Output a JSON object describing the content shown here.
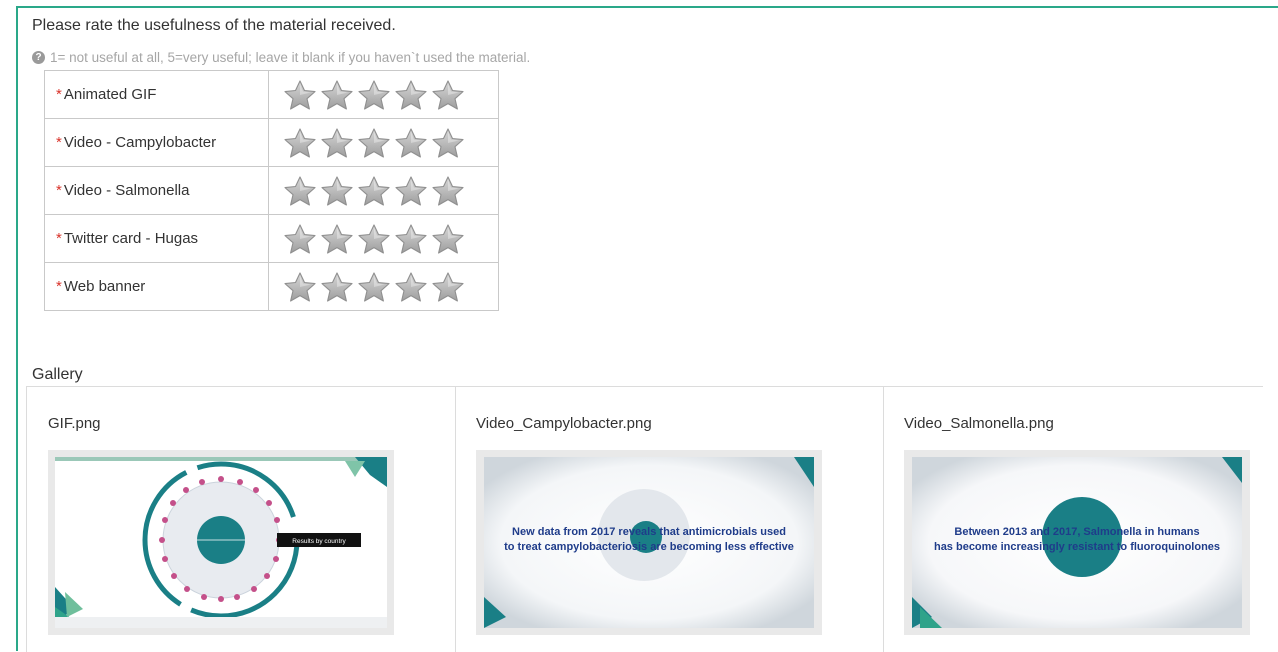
{
  "question": "Please rate the usefulness of the material received.",
  "hint": "1= not useful at all, 5=very useful; leave it blank if you haven`t used the material.",
  "required_mark": "*",
  "rating_scale_max": 5,
  "ratings": [
    {
      "label": "Animated GIF",
      "value": 0
    },
    {
      "label": "Video - Campylobacter",
      "value": 0
    },
    {
      "label": "Video - Salmonella",
      "value": 0
    },
    {
      "label": "Twitter card - Hugas",
      "value": 0
    },
    {
      "label": "Web banner",
      "value": 0
    }
  ],
  "gallery": {
    "title": "Gallery",
    "items": [
      {
        "filename": "GIF.png",
        "badge_text": "Results by country"
      },
      {
        "filename": "Video_Campylobacter.png",
        "caption_line1": "New data from 2017 reveals that antimicrobials used",
        "caption_line2": "to treat campylobacteriosis are becoming less effective"
      },
      {
        "filename": "Video_Salmonella.png",
        "caption_line1": "Between 2013 and 2017, Salmonella in humans",
        "caption_line2": "has become increasingly resistant to fluoroquinolones"
      }
    ]
  },
  "colors": {
    "frame": "#2aa889",
    "required": "#d9342b",
    "teal": "#1a7f86",
    "caption": "#1f3c8a"
  }
}
